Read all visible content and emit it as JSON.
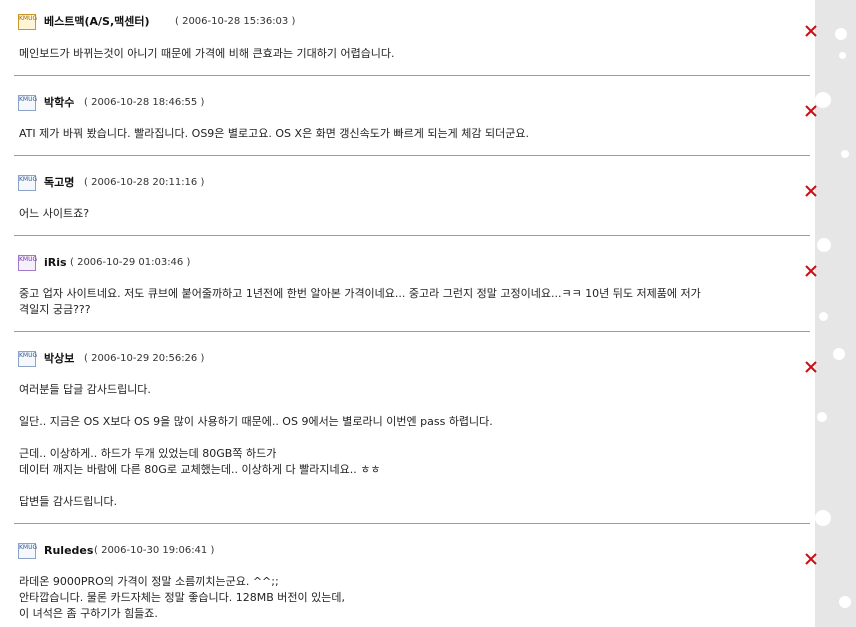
{
  "comments": [
    {
      "author": "베스트맥(A/S,맥센터)",
      "timestamp": "( 2006-10-28 15:36:03 )",
      "body": "메인보드가 바뀌는것이 아니기 때문에 가격에 비해 큰효과는 기대하기 어렵습니다.",
      "badge": "gold"
    },
    {
      "author": "박학수",
      "timestamp": "( 2006-10-28 18:46:55 )",
      "body": "ATI 제가 바꿔 봤습니다. 빨라집니다. OS9은 별로고요. OS X은 화면 갱신속도가 빠르게 되는게 체감 되더군요.",
      "badge": "blue"
    },
    {
      "author": "독고명",
      "timestamp": "( 2006-10-28 20:11:16 )",
      "body": "어느 사이트죠?",
      "badge": "blue"
    },
    {
      "author": "iRis",
      "timestamp": "( 2006-10-29 01:03:46 )",
      "body": "중고 업자 사이트네요. 저도 큐브에 붙어줄까하고 1년전에 한번 알아본 가격이네요... 중고라 그런지 정말 고정이네요...ㅋㅋ 10년 뒤도 저제품에 저가\n격일지 궁금???",
      "badge": "violet"
    },
    {
      "author": "박상보",
      "timestamp": "( 2006-10-29 20:56:26 )",
      "body": "여러분들 답글 감사드립니다.\n\n일단.. 지금은 OS X보다 OS 9을 많이 사용하기 때문에.. OS 9에서는 별로라니 이번엔 pass 하렵니다.\n\n근데.. 이상하게.. 하드가 두개 있었는데 80GB쪽 하드가\n데이터 깨지는 바람에 다른 80G로 교체했는데.. 이상하게 다 빨라지네요.. ㅎㅎ\n\n답변들 감사드립니다.",
      "badge": "blue"
    },
    {
      "author": "Ruledes",
      "timestamp": "( 2006-10-30 19:06:41 )",
      "body": "라데온 9000PRO의 가격이 정말 소름끼치는군요. ^^;;\n안타깝습니다. 물론 카드자체는 정말 좋습니다. 128MB 버전이 있는데,\n이 녀석은 좀 구하기가 힘들죠.",
      "badge": "blue"
    }
  ],
  "delete_icon": "close-icon",
  "level_badge_text": "KMUG",
  "colors": {
    "delete": "#cc1111",
    "divider": "#9a9a9a",
    "side_strip": "#e6e6e6"
  }
}
